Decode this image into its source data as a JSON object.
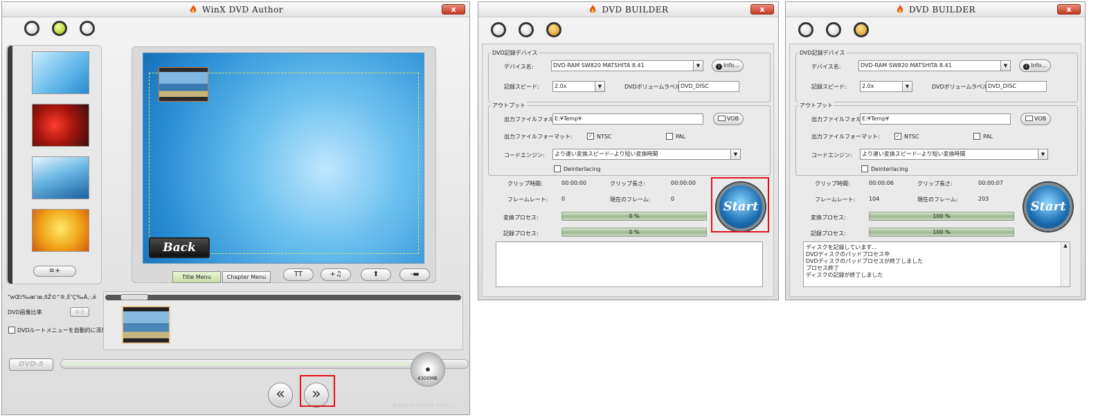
{
  "author": {
    "title": "WinX DVD Author",
    "close_label": "x",
    "tabs": {
      "title_menu": "Title Menu",
      "chapter_menu": "Chapter Menu"
    },
    "tool_buttons": {
      "text": "TT",
      "music": "+♫",
      "up": "⬆",
      "down": "-▬"
    },
    "back_label": "Back",
    "garbled_label": "\"wŒi‰æ‘œ‚ðŽ©“®‚É’Ç‰Á‚·‚é",
    "aspect_label": "DVD画像比率",
    "aspect_value": "4:3",
    "auto_root_menu_label": "DVDルートメニューを自動的に添加する",
    "dvd_badge": "DVD-5",
    "capacity": "4300MB",
    "watermark": "www.winxdvd.com",
    "nav_prev": "«",
    "nav_next": "»",
    "add_menu_icon": "≡+"
  },
  "builders": [
    {
      "title": "DVD BUILDER",
      "close_label": "x",
      "device_group": "DVD記録デバイス",
      "device_label": "デバイス名:",
      "device_value": "DVD-RAM SW820    MATSHITA 8.41",
      "info_label": "Info...",
      "speed_label": "記録スピード:",
      "speed_value": "2.0x",
      "volume_label": "DVDボリュームラベル:",
      "volume_value": "DVD_DISC",
      "output_group": "アウトプット",
      "folder_label": "出力ファイルフォルダ:",
      "folder_value": "E:¥Temp¥",
      "vob_label": "VOB",
      "format_label": "出力ファイルフォーマット:",
      "ntsc_label": "NTSC",
      "pal_label": "PAL",
      "engine_label": "コードエンジン:",
      "engine_value": "より速い変換スピード--より短い変換時間",
      "deinterlacing_label": "Deinterlacing",
      "clip_time_label": "クリップ時間:",
      "clip_time_value": "00:00:00",
      "clip_length_label": "クリップ長さ:",
      "clip_length_value": "00:00:00",
      "frame_rate_label": "フレームレート:",
      "frame_rate_value": "0",
      "current_frame_label": "現在のフレーム:",
      "current_frame_value": "0",
      "convert_label": "変換プロセス:",
      "convert_value": "0 %",
      "convert_fraction": 0,
      "record_label": "記録プロセス:",
      "record_value": "0 %",
      "record_fraction": 0,
      "start_label": "Start",
      "log_lines": []
    },
    {
      "title": "DVD BUILDER",
      "close_label": "x",
      "device_group": "DVD記録デバイス",
      "device_label": "デバイス名:",
      "device_value": "DVD-RAM SW820    MATSHITA 8.41",
      "info_label": "Info...",
      "speed_label": "記録スピード:",
      "speed_value": "2.0x",
      "volume_label": "DVDボリュームラベル:",
      "volume_value": "DVD_DISC",
      "output_group": "アウトプット",
      "folder_label": "出力ファイルフォルダ:",
      "folder_value": "E:¥Temp¥",
      "vob_label": "VOB",
      "format_label": "出力ファイルフォーマット:",
      "ntsc_label": "NTSC",
      "pal_label": "PAL",
      "engine_label": "コードエンジン:",
      "engine_value": "より速い変換スピード--より短い変換時間",
      "deinterlacing_label": "Deinterlacing",
      "clip_time_label": "クリップ時間:",
      "clip_time_value": "00:00:06",
      "clip_length_label": "クリップ長さ:",
      "clip_length_value": "00:00:07",
      "frame_rate_label": "フレームレート:",
      "frame_rate_value": "104",
      "current_frame_label": "現在のフレーム:",
      "current_frame_value": "203",
      "convert_label": "変換プロセス:",
      "convert_value": "100 %",
      "convert_fraction": 1,
      "record_label": "記録プロセス:",
      "record_value": "100 %",
      "record_fraction": 1,
      "start_label": "Start",
      "log_lines": [
        "ディスクを記録しています...",
        "DVDディスクのパッドプロセス中",
        "DVDディスクのパッドプロセスが終了しました",
        "プロセス終了",
        "ディスクの記録が終了しました"
      ]
    }
  ]
}
